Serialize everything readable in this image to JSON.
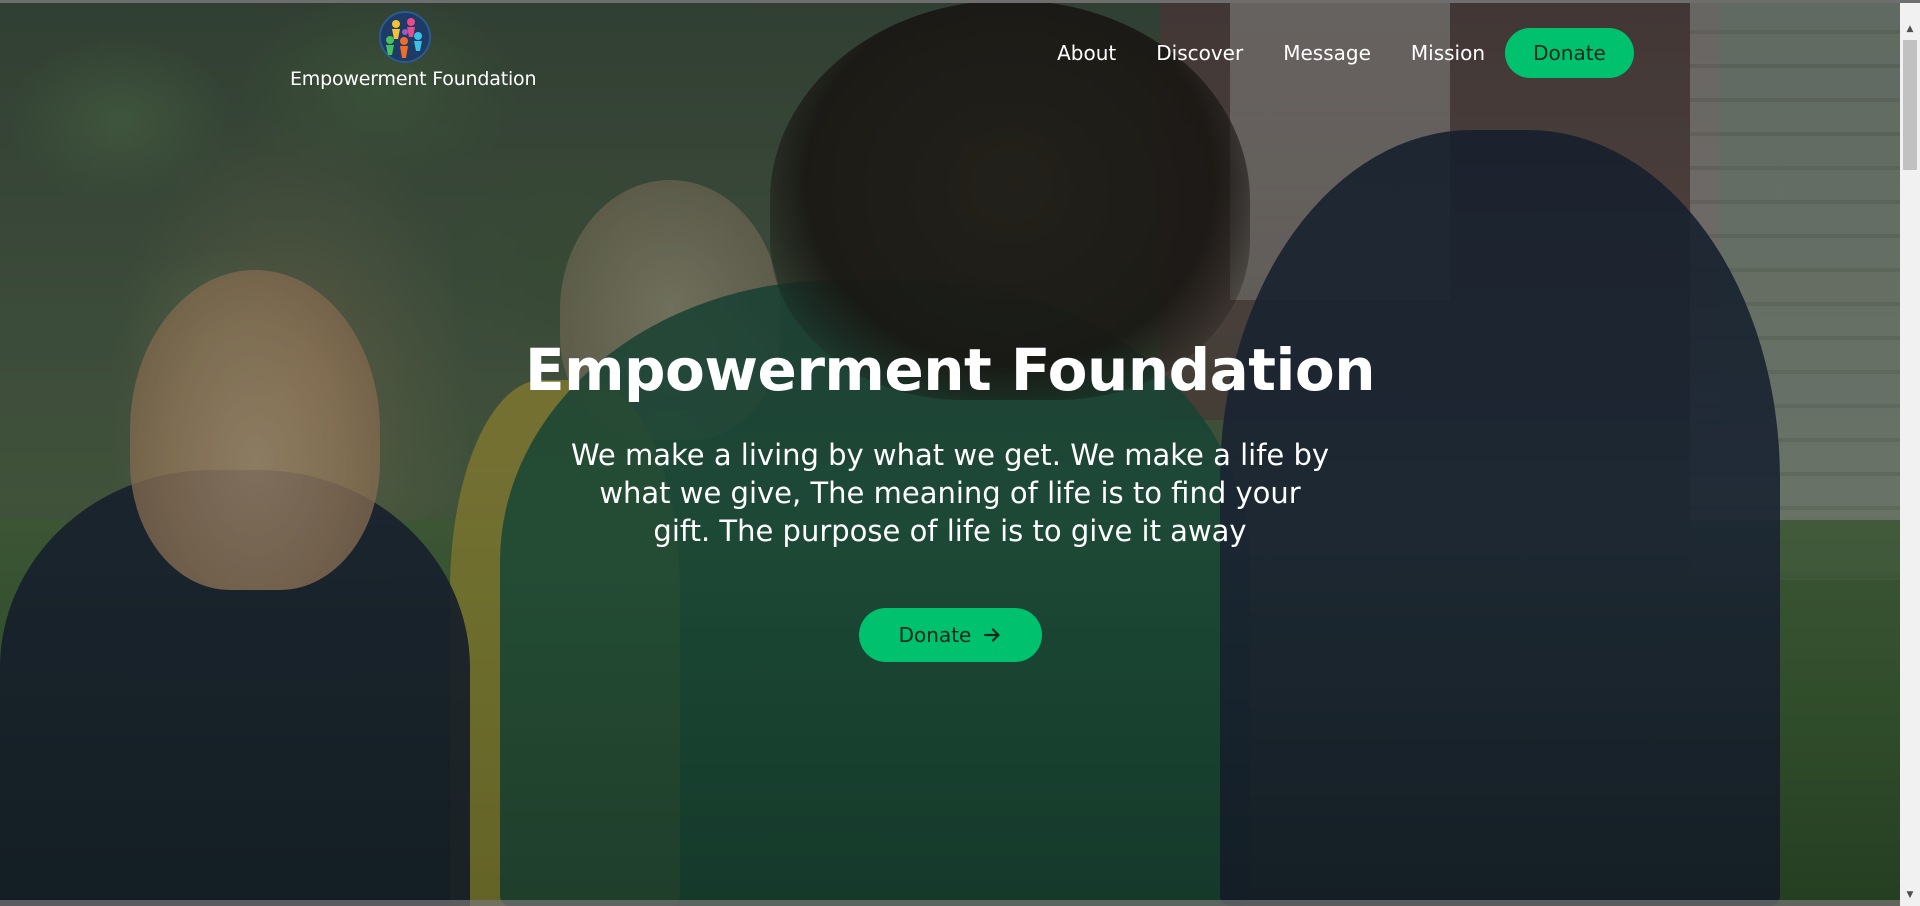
{
  "brand": {
    "name": "Empowerment Foundation",
    "logo_icon": "globe-people-icon"
  },
  "nav": {
    "items": [
      {
        "label": "About"
      },
      {
        "label": "Discover"
      },
      {
        "label": "Message"
      },
      {
        "label": "Mission"
      }
    ],
    "donate_label": "Donate"
  },
  "hero": {
    "title": "Empowerment Foundation",
    "tagline": "We make a living by what we get. We make a life by what we give, The meaning of life is to find your gift. The purpose of life is to give it away",
    "cta_label": "Donate",
    "cta_icon": "arrow-right-icon"
  },
  "colors": {
    "accent": "#00c16e",
    "button_text": "#0d2a1c",
    "text_on_image": "#ffffff"
  }
}
